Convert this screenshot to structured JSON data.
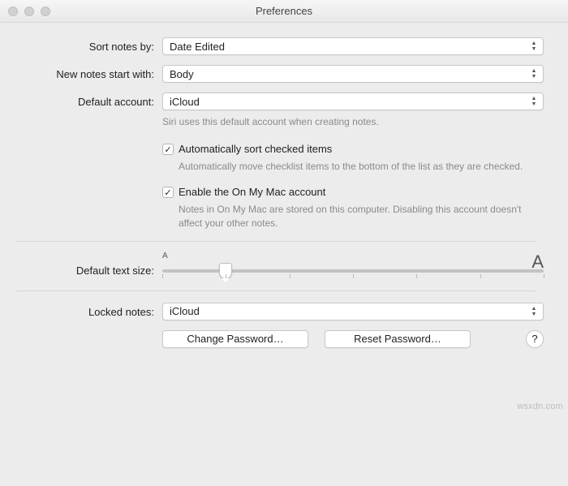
{
  "window": {
    "title": "Preferences"
  },
  "labels": {
    "sort_notes": "Sort notes by:",
    "new_notes": "New notes start with:",
    "default_account": "Default account:",
    "default_text_size": "Default text size:",
    "locked_notes": "Locked notes:"
  },
  "selects": {
    "sort_notes_value": "Date Edited",
    "new_notes_value": "Body",
    "default_account_value": "iCloud",
    "locked_notes_value": "iCloud"
  },
  "descriptions": {
    "default_account": "Siri uses this default account when creating notes.",
    "auto_sort": "Automatically move checklist items to the bottom of the list as they are checked.",
    "on_my_mac": "Notes in On My Mac are stored on this computer. Disabling this account doesn't affect your other notes."
  },
  "checkboxes": {
    "auto_sort_label": "Automatically sort checked items",
    "auto_sort_checked": true,
    "on_my_mac_label": "Enable the On My Mac account",
    "on_my_mac_checked": true
  },
  "slider": {
    "small_label": "A",
    "large_label": "A",
    "ticks": 7,
    "value_index": 1
  },
  "buttons": {
    "change_password": "Change Password…",
    "reset_password": "Reset Password…",
    "help": "?"
  },
  "watermark": "wsxdn.com"
}
